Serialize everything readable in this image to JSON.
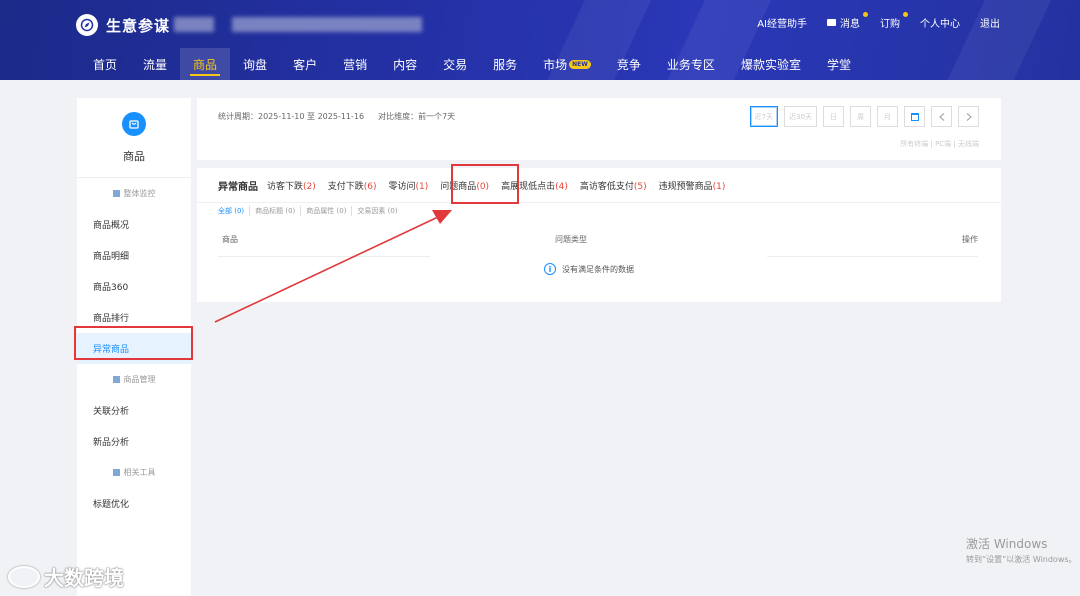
{
  "header": {
    "brand": "生意参谋",
    "top_links": [
      "AI经营助手",
      "消息",
      "订购",
      "个人中心",
      "退出"
    ],
    "nav_tabs": [
      "首页",
      "流量",
      "商品",
      "询盘",
      "客户",
      "营销",
      "内容",
      "交易",
      "服务",
      "市场",
      "竞争",
      "业务专区",
      "爆款实验室",
      "学堂"
    ],
    "active_tab": "商品",
    "new_badge": "NEW",
    "accent_color": "#f5c518"
  },
  "sidebar": {
    "title": "商品",
    "group_overall": "整体监控",
    "items_a": [
      "商品概况",
      "商品明细",
      "商品360",
      "商品排行",
      "异常商品"
    ],
    "group_manage": "商品管理",
    "items_b": [
      "关联分析",
      "新品分析"
    ],
    "group_tools": "相关工具",
    "items_c": [
      "标题优化"
    ]
  },
  "period": {
    "label": "统计周期：2025-11-10 至 2025-11-16",
    "compare": "对比维度：前一个7天",
    "buttons": [
      "近7天",
      "近30天",
      "日",
      "周",
      "月"
    ],
    "devices": "所有终端 | PC端 | 无线端"
  },
  "abnormal": {
    "title": "异常商品",
    "tabs": [
      {
        "label": "访客下跌",
        "count": "(2)"
      },
      {
        "label": "支付下跌",
        "count": "(6)"
      },
      {
        "label": "零访问",
        "count": "(1)"
      },
      {
        "label": "问题商品",
        "count": "(0)"
      },
      {
        "label": "高展现低点击",
        "count": "(4)"
      },
      {
        "label": "高访客低支付",
        "count": "(5)"
      },
      {
        "label": "违规预警商品",
        "count": "(1)"
      }
    ],
    "subtabs": [
      "全部 (0)",
      "商品标题 (0)",
      "商品属性 (0)",
      "交易因素 (0)"
    ],
    "columns": [
      "商品",
      "问题类型",
      "操作"
    ],
    "empty_text": "没有满足条件的数据"
  },
  "annotation_color": "#e0383b",
  "watermark": {
    "brand": "大数跨境",
    "activate_title": "激活 Windows",
    "activate_sub": "转到“设置”以激活 Windows。"
  }
}
